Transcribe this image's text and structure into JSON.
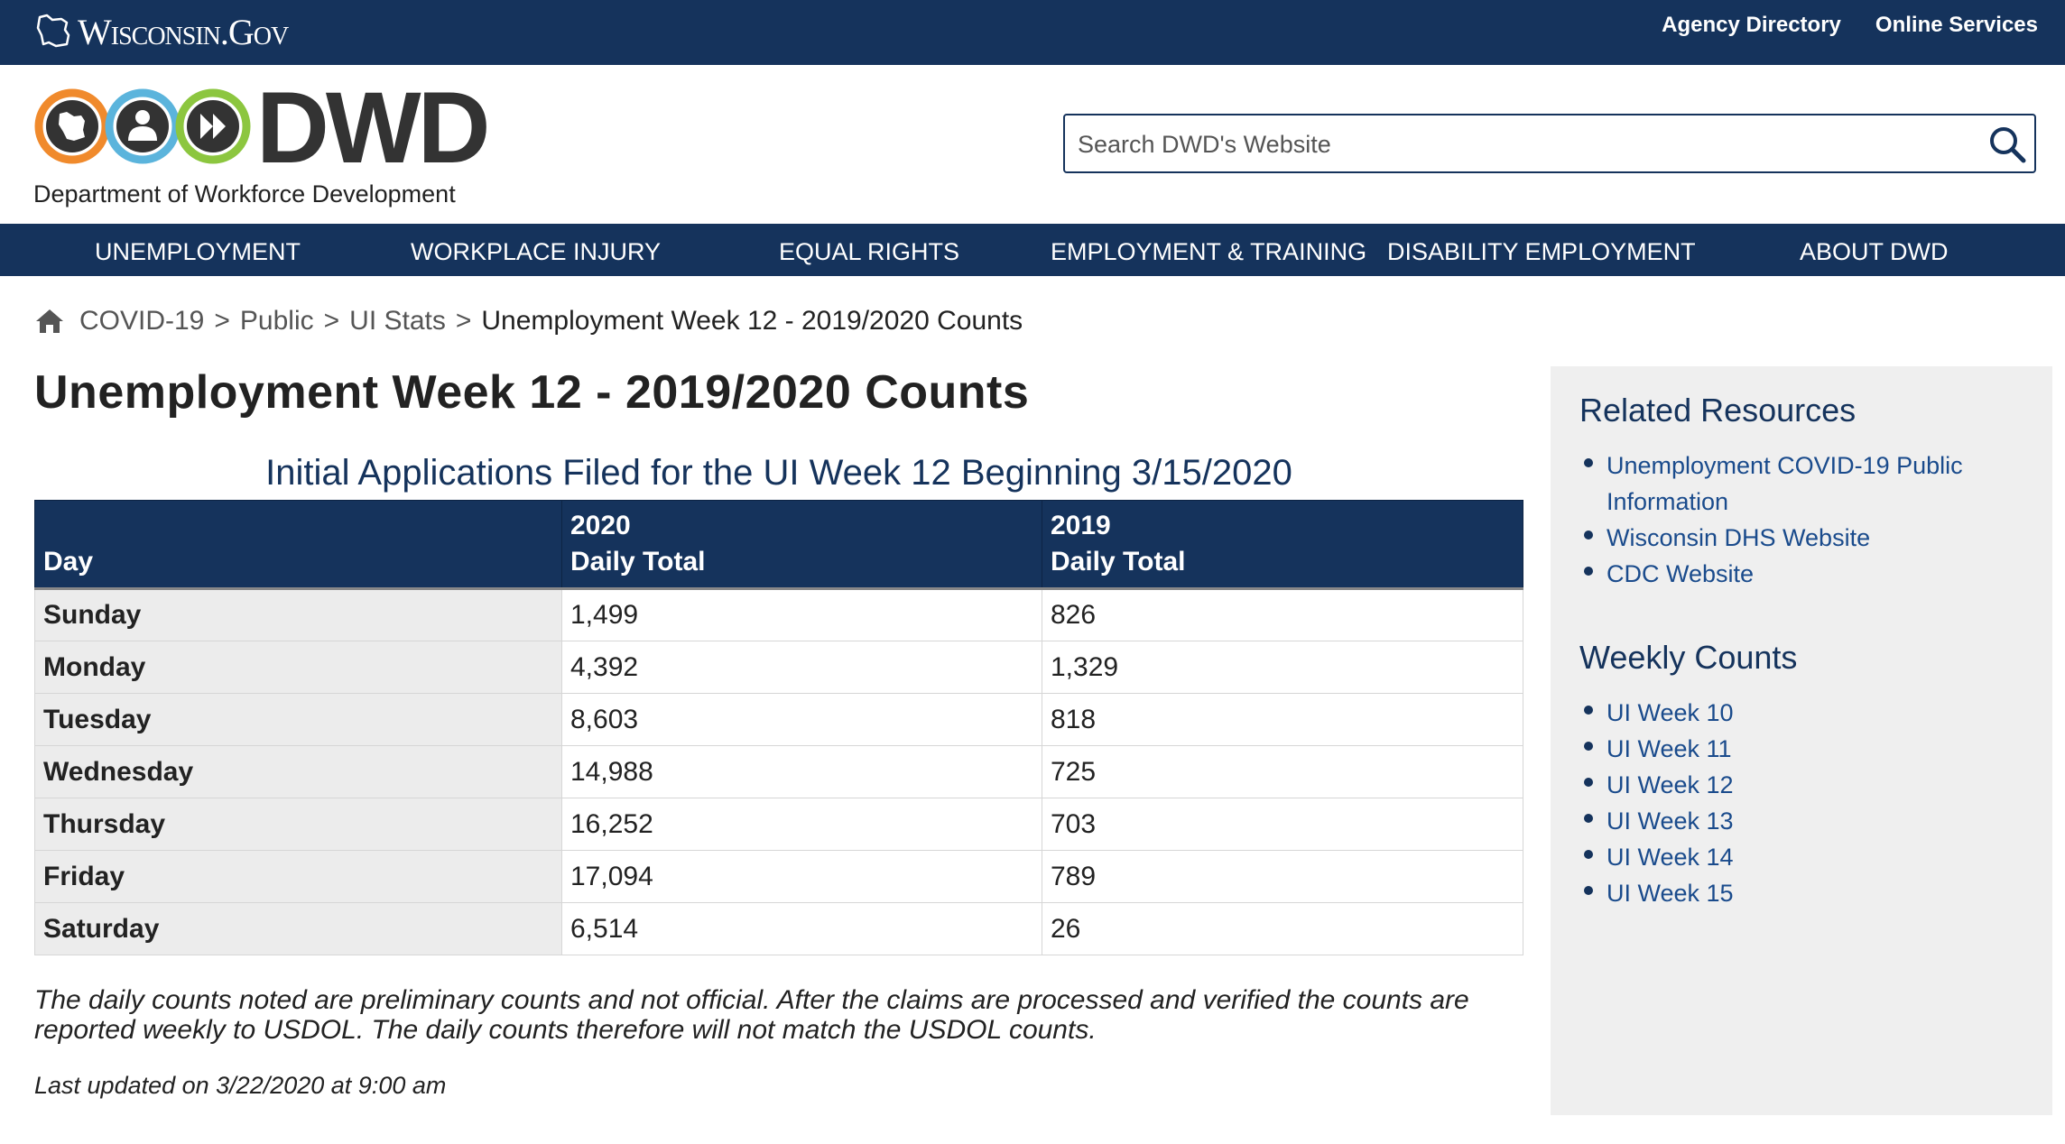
{
  "topbar": {
    "site_name": "Wisconsin.Gov",
    "links": [
      "Agency Directory",
      "Online Services"
    ]
  },
  "header": {
    "logo_text": "DWD",
    "dept_name": "Department of Workforce Development",
    "search_placeholder": "Search DWD's Website"
  },
  "nav": {
    "items": [
      "UNEMPLOYMENT",
      "WORKPLACE INJURY",
      "EQUAL RIGHTS",
      "EMPLOYMENT & TRAINING",
      "DISABILITY EMPLOYMENT",
      "ABOUT DWD"
    ]
  },
  "breadcrumb": {
    "items": [
      "COVID-19",
      "Public",
      "UI Stats"
    ],
    "separator": ">",
    "current": "Unemployment Week 12 - 2019/2020 Counts"
  },
  "main": {
    "title": "Unemployment Week 12 - 2019/2020 Counts",
    "table_caption": "Initial Applications Filed for the UI Week 12 Beginning 3/15/2020",
    "table": {
      "headers": [
        {
          "line1": "",
          "line2": "Day"
        },
        {
          "line1": "2020",
          "line2": "Daily Total"
        },
        {
          "line1": "2019",
          "line2": "Daily Total"
        }
      ],
      "rows": [
        [
          "Sunday",
          "1,499",
          "826"
        ],
        [
          "Monday",
          "4,392",
          "1,329"
        ],
        [
          "Tuesday",
          "8,603",
          "818"
        ],
        [
          "Wednesday",
          "14,988",
          "725"
        ],
        [
          "Thursday",
          "16,252",
          "703"
        ],
        [
          "Friday",
          "17,094",
          "789"
        ],
        [
          "Saturday",
          "6,514",
          "26"
        ]
      ]
    },
    "note": "The daily counts noted are preliminary counts and not official. After the claims are processed and verified the counts are reported weekly to USDOL. The daily counts therefore will not match the USDOL counts.",
    "updated": "Last updated on 3/22/2020 at 9:00 am"
  },
  "sidebar": {
    "related_title": "Related Resources",
    "related_links": [
      "Unemployment COVID-19 Public Information",
      "Wisconsin DHS Website",
      "CDC Website"
    ],
    "weekly_title": "Weekly Counts",
    "weekly_links": [
      "UI Week 10",
      "UI Week 11",
      "UI Week 12",
      "UI Week 13",
      "UI Week 14",
      "UI Week 15"
    ]
  },
  "colors": {
    "navy": "#15335c",
    "link": "#1a4b8c",
    "circle_orange": "#f08a2c",
    "circle_blue": "#5bb4dc",
    "circle_green": "#8cc63f"
  },
  "icons": [
    "wisconsin-state-icon",
    "wisconsin-silhouette-icon",
    "person-icon",
    "forward-arrows-icon",
    "search-icon",
    "home-icon"
  ]
}
